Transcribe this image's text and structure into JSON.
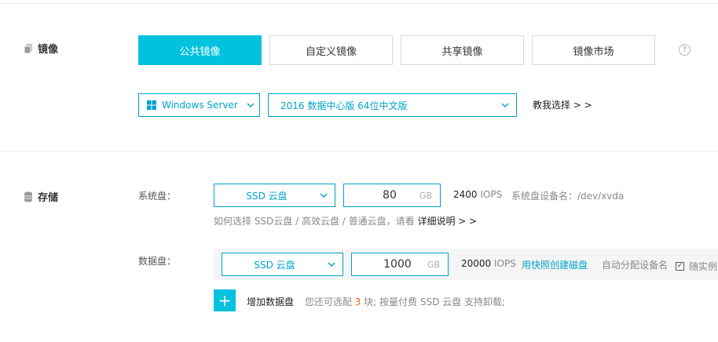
{
  "image_section": {
    "title": "镜像",
    "tabs": [
      "公共镜像",
      "自定义镜像",
      "共享镜像",
      "镜像市场"
    ],
    "active_tab": 0,
    "help_icon": "question-circle-icon",
    "os_select": "Windows Server",
    "version_select": "2016 数据中心版 64位中文版",
    "help_choose": "教我选择 > >"
  },
  "storage_section": {
    "title": "存储",
    "system_disk": {
      "label": "系统盘：",
      "type": "SSD 云盘",
      "size": "80",
      "unit": "GB",
      "iops_value": "2400",
      "iops_label": "IOPS",
      "device_label": "系统盘设备名：/dev/xvda"
    },
    "help_text": "如何选择 SSD云盘 / 高效云盘 / 普通云盘，请看",
    "help_link": "详细说明 > >",
    "data_disk": {
      "label": "数据盘：",
      "type": "SSD 云盘",
      "size": "1000",
      "unit": "GB",
      "iops_value": "20000",
      "iops_label": "IOPS",
      "snapshot_link": "用快照创建磁盘",
      "auto_assign": "自动分配设备名",
      "release_with": "随实例",
      "release_checked": true
    },
    "add_button": "+",
    "add_label": "增加数据盘",
    "remaining_prefix": "您还可选配",
    "remaining_count": "3",
    "remaining_suffix": "块; 按量付费 SSD 云盘 支持卸载;"
  },
  "colors": {
    "accent": "#00c1de",
    "link": "#00a2ca",
    "highlight": "#ff6600"
  }
}
